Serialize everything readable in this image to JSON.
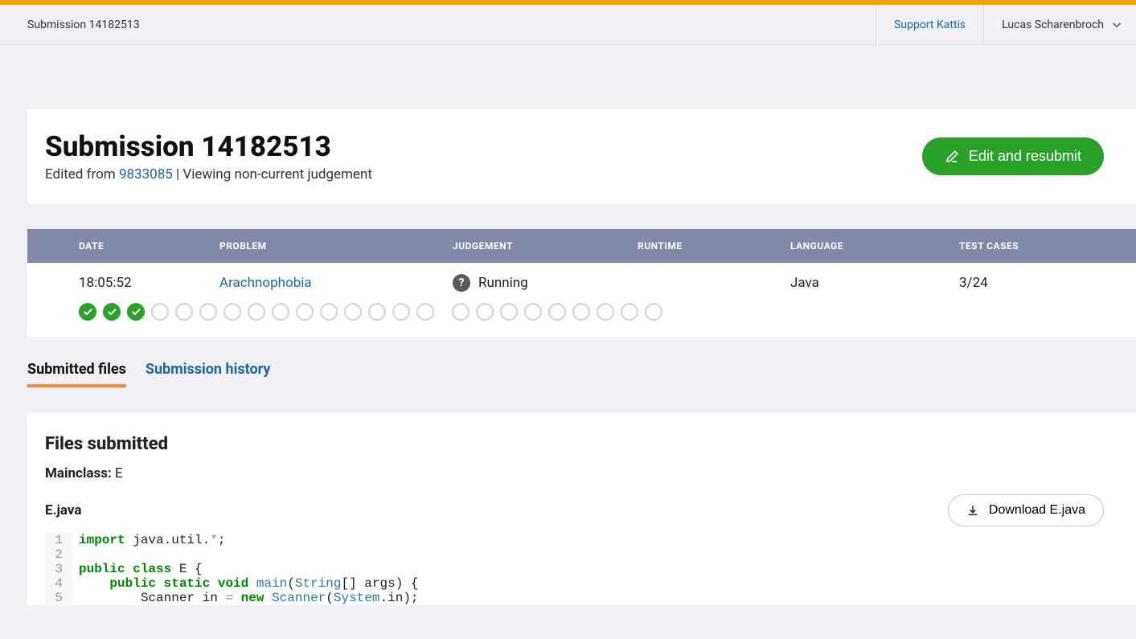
{
  "accent_color": "#f0a30a",
  "header": {
    "pageLabel": "Submission 14182513",
    "supportLink": "Support Kattis",
    "userName": "Lucas Scharenbroch"
  },
  "title": "Submission 14182513",
  "subtitle": {
    "editedPrefix": "Edited from ",
    "editedId": "9833085",
    "separator": " | ",
    "viewing": "Viewing non-current judgement"
  },
  "editButton": "Edit and resubmit",
  "table": {
    "headers": {
      "date": "DATE",
      "problem": "PROBLEM",
      "judgement": "JUDGEMENT",
      "runtime": "RUNTIME",
      "language": "LANGUAGE",
      "testcases": "TEST CASES"
    },
    "row": {
      "date": "18:05:52",
      "problem": "Arachnophobia",
      "judgement": "Running",
      "runtime": "",
      "language": "Java",
      "testcases": "3/24"
    }
  },
  "testcases": {
    "passed": 3,
    "total": 24,
    "gapAfter": 15
  },
  "tabs": {
    "submitted": "Submitted files",
    "history": "Submission history"
  },
  "files": {
    "title": "Files submitted",
    "mainclassLabel": "Mainclass:",
    "mainclassValue": "E",
    "filename": "E.java",
    "downloadLabel": "Download E.java",
    "code": [
      {
        "n": 1,
        "tokens": [
          {
            "t": "import",
            "c": "kw"
          },
          {
            "t": " java.util."
          },
          {
            "t": "*",
            "c": "op"
          },
          {
            "t": ";"
          }
        ]
      },
      {
        "n": 2,
        "tokens": []
      },
      {
        "n": 3,
        "tokens": [
          {
            "t": "public",
            "c": "kw"
          },
          {
            "t": " "
          },
          {
            "t": "class",
            "c": "kw"
          },
          {
            "t": " E {"
          }
        ]
      },
      {
        "n": 4,
        "tokens": [
          {
            "t": "    "
          },
          {
            "t": "public",
            "c": "kw"
          },
          {
            "t": " "
          },
          {
            "t": "static",
            "c": "kw"
          },
          {
            "t": " "
          },
          {
            "t": "void",
            "c": "kw"
          },
          {
            "t": " "
          },
          {
            "t": "main",
            "c": "type"
          },
          {
            "t": "("
          },
          {
            "t": "String",
            "c": "type"
          },
          {
            "t": "[] args) {"
          }
        ]
      },
      {
        "n": 5,
        "tokens": [
          {
            "t": "        Scanner in "
          },
          {
            "t": "=",
            "c": "op"
          },
          {
            "t": " "
          },
          {
            "t": "new",
            "c": "kw"
          },
          {
            "t": " "
          },
          {
            "t": "Scanner",
            "c": "type"
          },
          {
            "t": "("
          },
          {
            "t": "System",
            "c": "type"
          },
          {
            "t": ".in);"
          }
        ]
      }
    ]
  }
}
